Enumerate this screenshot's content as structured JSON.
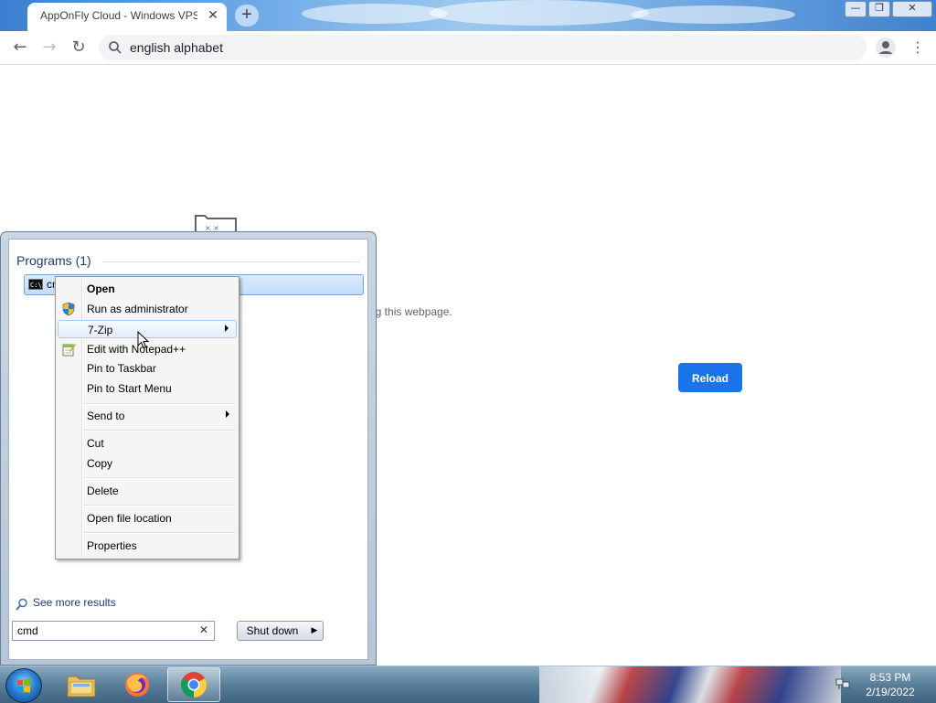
{
  "browser": {
    "tab_title": "AppOnFly Cloud - Windows VPS",
    "tab_close": "✕",
    "new_tab": "+",
    "window_buttons": {
      "minimize": "—",
      "maximize": "❐",
      "close": "✕"
    },
    "nav": {
      "back": "←",
      "forward": "→",
      "reload": "↻"
    },
    "omnibox_value": "english alphabet",
    "menu": "⋮"
  },
  "page": {
    "error_text_fragment": "ng this webpage.",
    "reload_label": "Reload"
  },
  "start_menu": {
    "programs_header": "Programs (1)",
    "program_item": "cmd",
    "cmd_icon_text": "C:\\",
    "see_more": "See more results",
    "search_value": "cmd",
    "search_clear": "✕",
    "shutdown_label": "Shut down",
    "shutdown_arrow": "▶"
  },
  "context_menu": {
    "items": [
      {
        "label": "Open",
        "bold": true
      },
      {
        "label": "Run as administrator",
        "icon": "shield-icon"
      },
      {
        "label": "7-Zip",
        "submenu": true,
        "highlighted": true
      },
      {
        "label": "Edit with Notepad++",
        "icon": "notepadpp-icon"
      },
      {
        "label": "Pin to Taskbar"
      },
      {
        "label": "Pin to Start Menu"
      },
      {
        "label": "Send to",
        "submenu": true
      },
      {
        "label": "Cut"
      },
      {
        "label": "Copy"
      },
      {
        "label": "Delete"
      },
      {
        "label": "Open file location"
      },
      {
        "label": "Properties"
      }
    ]
  },
  "taskbar": {
    "apps": [
      {
        "name": "windows-explorer",
        "icon": "folder-icon"
      },
      {
        "name": "firefox",
        "icon": "firefox-icon"
      },
      {
        "name": "chrome",
        "icon": "chrome-icon",
        "active": true
      }
    ],
    "clock_time": "8:53 PM",
    "clock_date": "2/19/2022"
  },
  "colors": {
    "accent_blue": "#1a73e8",
    "title_gradient": "#3a7fd0",
    "start_menu_header": "#1e3a73",
    "context_hover": "#e3eefb"
  }
}
